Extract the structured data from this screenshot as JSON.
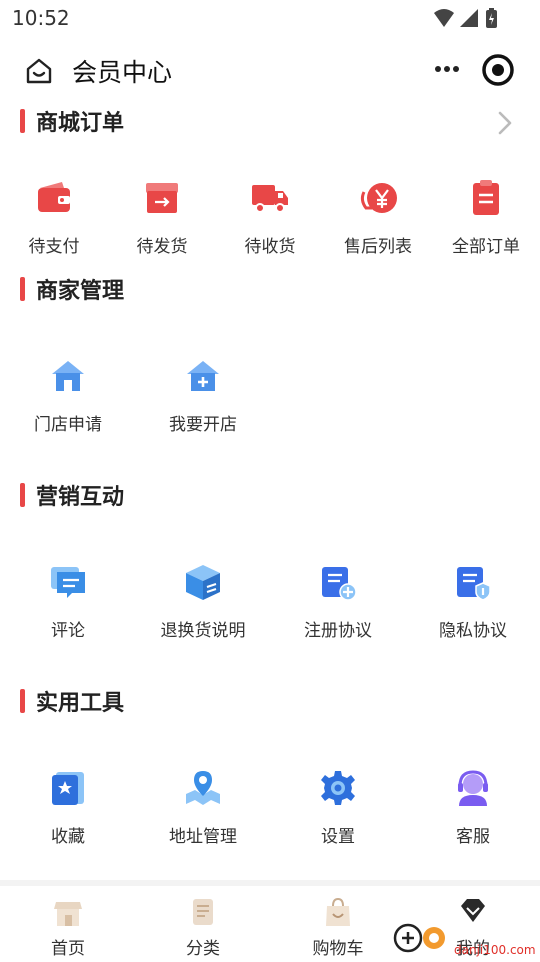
{
  "status": {
    "time": "10:52"
  },
  "header": {
    "title": "会员中心"
  },
  "sections": {
    "orders": {
      "title": "商城订单",
      "items": [
        {
          "label": "待支付",
          "icon": "wallet-icon"
        },
        {
          "label": "待发货",
          "icon": "box-ship-icon"
        },
        {
          "label": "待收货",
          "icon": "truck-icon"
        },
        {
          "label": "售后列表",
          "icon": "refund-yen-icon"
        },
        {
          "label": "全部订单",
          "icon": "clipboard-icon"
        }
      ]
    },
    "merchant": {
      "title": "商家管理",
      "items": [
        {
          "label": "门店申请",
          "icon": "store-house-icon"
        },
        {
          "label": "我要开店",
          "icon": "store-add-icon"
        }
      ]
    },
    "marketing": {
      "title": "营销互动",
      "items": [
        {
          "label": "评论",
          "icon": "comment-icon"
        },
        {
          "label": "退换货说明",
          "icon": "exchange-box-icon"
        },
        {
          "label": "注册协议",
          "icon": "register-doc-icon"
        },
        {
          "label": "隐私协议",
          "icon": "privacy-doc-icon"
        }
      ]
    },
    "tools": {
      "title": "实用工具",
      "items": [
        {
          "label": "收藏",
          "icon": "favorite-star-icon"
        },
        {
          "label": "地址管理",
          "icon": "location-map-icon"
        },
        {
          "label": "设置",
          "icon": "settings-gear-icon"
        },
        {
          "label": "客服",
          "icon": "customer-service-icon"
        }
      ]
    }
  },
  "tabbar": {
    "items": [
      {
        "label": "首页",
        "icon": "home-shop-icon"
      },
      {
        "label": "分类",
        "icon": "category-scroll-icon"
      },
      {
        "label": "购物车",
        "icon": "shopping-bag-icon"
      },
      {
        "label": "我的",
        "icon": "profile-diamond-icon"
      }
    ]
  },
  "watermark": {
    "text": "danji100.com"
  },
  "colors": {
    "accent_red": "#e84747",
    "accent_blue": "#4a7bf0"
  }
}
